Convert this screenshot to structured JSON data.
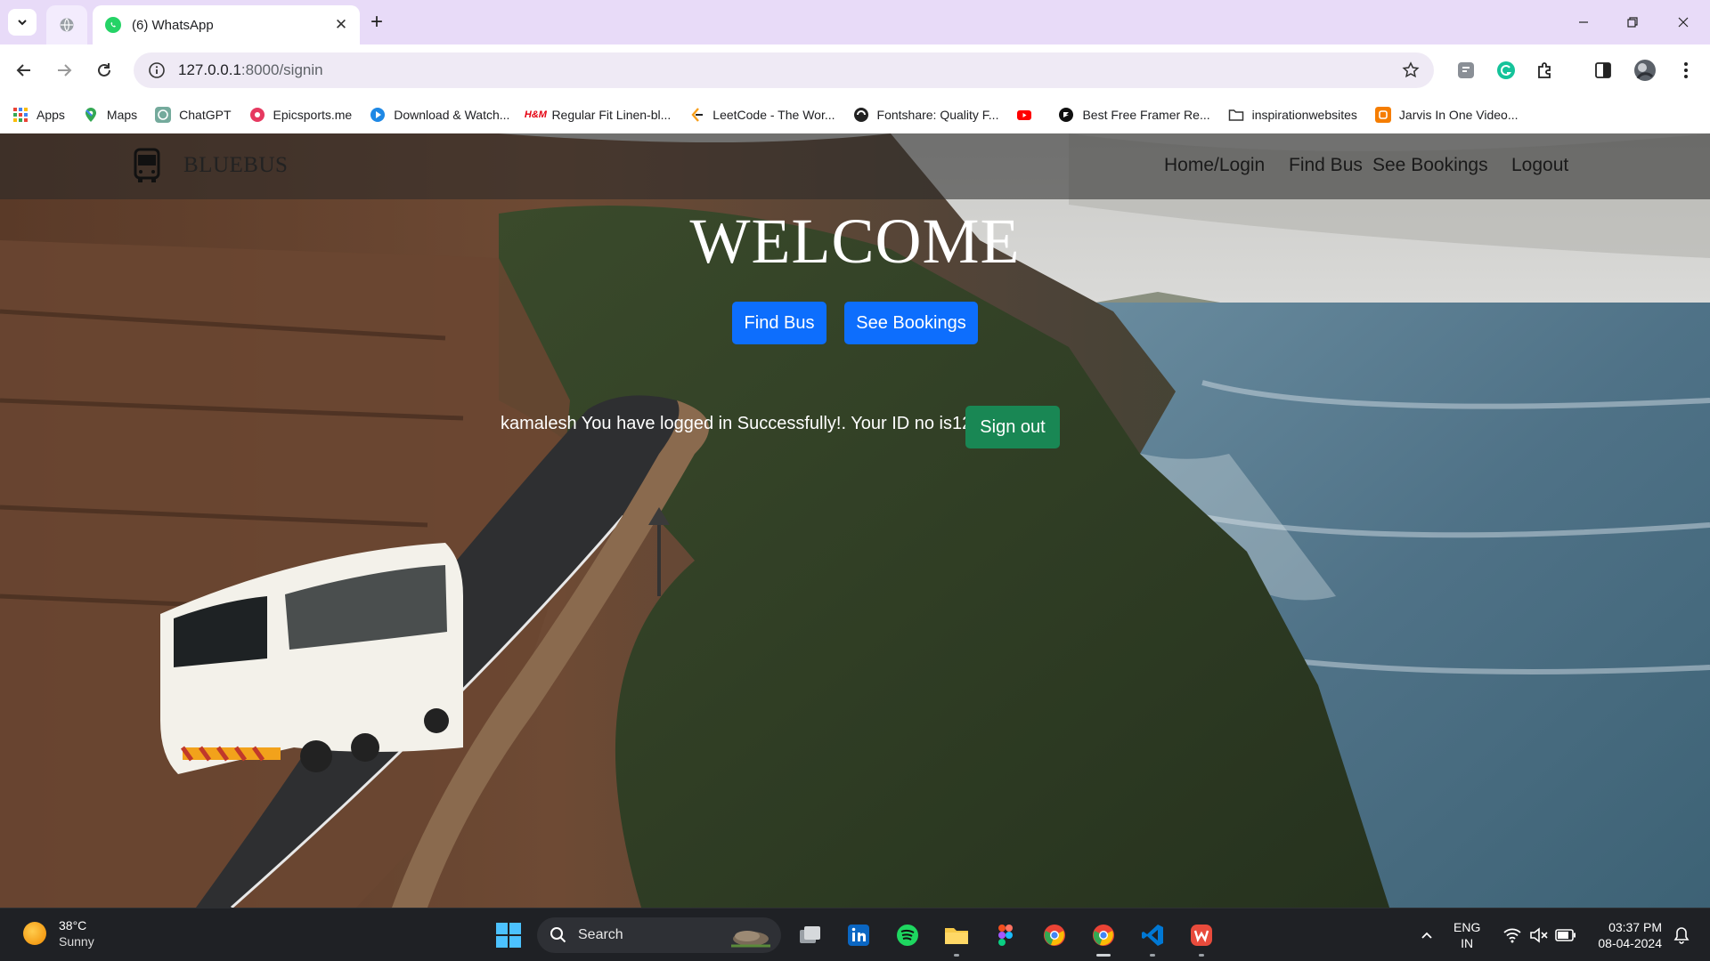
{
  "browser": {
    "tabs": [
      {
        "title": "(6) WhatsApp",
        "active": true
      }
    ],
    "url": {
      "host": "127.0.0.1",
      "path": ":8000/signin"
    },
    "bookmarks": [
      {
        "label": "Apps",
        "icon": "apps-grid-icon"
      },
      {
        "label": "Maps",
        "icon": "maps-pin-icon"
      },
      {
        "label": "ChatGPT",
        "icon": "chatgpt-icon"
      },
      {
        "label": "Epicsports.me",
        "icon": "epicsports-icon"
      },
      {
        "label": "Download & Watch...",
        "icon": "play-icon"
      },
      {
        "label": "Regular Fit Linen-bl...",
        "icon": "hm-icon"
      },
      {
        "label": "LeetCode - The Wor...",
        "icon": "leetcode-icon"
      },
      {
        "label": "Fontshare: Quality F...",
        "icon": "fontshare-icon"
      },
      {
        "label": "",
        "icon": "youtube-icon"
      },
      {
        "label": "Best Free Framer Re...",
        "icon": "framer-icon"
      },
      {
        "label": "inspirationwebsites",
        "icon": "folder-icon"
      },
      {
        "label": "Jarvis In One Video...",
        "icon": "blogger-icon"
      }
    ]
  },
  "site": {
    "brand": "BLUEBUS",
    "nav": {
      "home_login": "Home/Login",
      "find_bus": "Find Bus",
      "see_bookings": "See Bookings",
      "logout": "Logout"
    },
    "hero": {
      "title": "WELCOME",
      "find_bus_btn": "Find Bus",
      "see_bookings_btn": "See Bookings",
      "status_text": "kamalesh You have logged in Successfully!. Your ID no is12",
      "sign_out_btn": "Sign out"
    },
    "colors": {
      "primary": "#0d6efd",
      "success": "#198754"
    }
  },
  "taskbar": {
    "weather": {
      "temp": "38°C",
      "condition": "Sunny"
    },
    "search_label": "Search",
    "language": {
      "line1": "ENG",
      "line2": "IN"
    },
    "clock": {
      "time": "03:37 PM",
      "date": "08-04-2024"
    }
  }
}
